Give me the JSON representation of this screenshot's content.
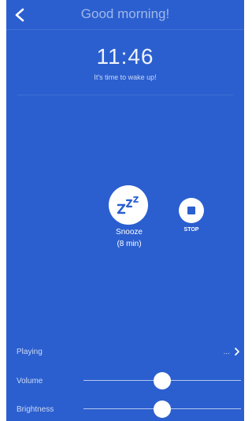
{
  "header": {
    "title": "Good morning!",
    "back_icon": "chevron-left-icon"
  },
  "alarm": {
    "time": "11:46",
    "message": "It's time to wake up!"
  },
  "actions": {
    "snooze": {
      "icon": "zzz-icon",
      "label": "Snooze",
      "duration": "(8 min)"
    },
    "stop": {
      "icon": "stop-icon",
      "label": "STOP"
    }
  },
  "controls": {
    "playing": {
      "label": "Playing",
      "value": "...",
      "icon": "chevron-right-icon"
    },
    "volume": {
      "label": "Volume",
      "level": 0.5
    },
    "brightness": {
      "label": "Brightness",
      "level": 0.5
    }
  },
  "colors": {
    "background": "#2b5fcf",
    "foreground": "#ffffff"
  }
}
